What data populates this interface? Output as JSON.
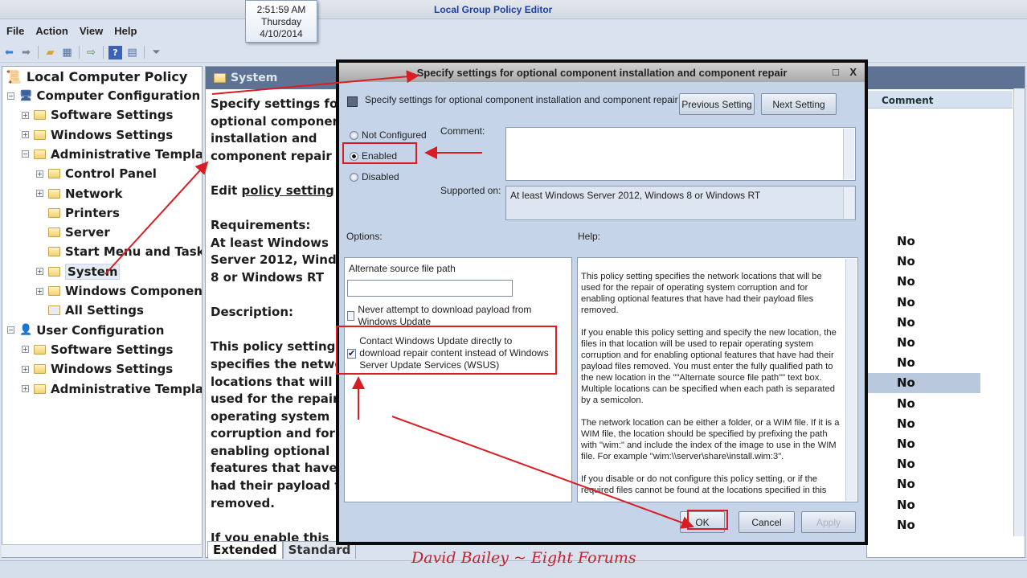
{
  "window": {
    "title": "Local Group Policy Editor"
  },
  "clock": {
    "time": "2:51:59 AM",
    "day": "Thursday",
    "date": "4/10/2014"
  },
  "menu": [
    "File",
    "Action",
    "View",
    "Help"
  ],
  "toolbar_icons": [
    "back-arrow-icon",
    "forward-arrow-icon",
    "up-folder-icon",
    "show-hide-tree-icon",
    "export-list-icon",
    "help-icon",
    "properties-icon",
    "filter-icon"
  ],
  "tree": {
    "root": "Local Computer Policy",
    "items": [
      {
        "label": "Computer Configuration",
        "level": 0,
        "expander": "minus"
      },
      {
        "label": "Software Settings",
        "level": 1,
        "expander": "plus"
      },
      {
        "label": "Windows Settings",
        "level": 1,
        "expander": "plus"
      },
      {
        "label": "Administrative Templates",
        "level": 1,
        "expander": "minus"
      },
      {
        "label": "Control Panel",
        "level": 2,
        "expander": "plus"
      },
      {
        "label": "Network",
        "level": 2,
        "expander": "plus"
      },
      {
        "label": "Printers",
        "level": 2,
        "expander": "none"
      },
      {
        "label": "Server",
        "level": 2,
        "expander": "none"
      },
      {
        "label": "Start Menu and Taskbar",
        "level": 2,
        "expander": "none"
      },
      {
        "label": "System",
        "level": 2,
        "expander": "plus",
        "selected": true
      },
      {
        "label": "Windows Components",
        "level": 2,
        "expander": "plus"
      },
      {
        "label": "All Settings",
        "level": 2,
        "expander": "none"
      },
      {
        "label": "User Configuration",
        "level": 0,
        "expander": "minus"
      },
      {
        "label": "Software Settings",
        "level": 1,
        "expander": "plus"
      },
      {
        "label": "Windows Settings",
        "level": 1,
        "expander": "plus"
      },
      {
        "label": "Administrative Templates",
        "level": 1,
        "expander": "plus"
      }
    ]
  },
  "middle": {
    "header": "System",
    "title": "Specify settings for optional component installation and component repair",
    "edit_prefix": "Edit",
    "edit_link": "policy setting",
    "requirements_label": "Requirements:",
    "requirements": "At least Windows Server 2012, Windows 8 or Windows RT",
    "description_label": "Description:",
    "description": "This policy setting specifies the network locations that will be used for the repair of operating system corruption and for enabling optional features that have had their payload files removed.",
    "more": "If you enable this",
    "tabs": [
      "Extended",
      "Standard"
    ]
  },
  "list": {
    "column": "Comment",
    "values": [
      "No",
      "No",
      "No",
      "No",
      "No",
      "No",
      "No",
      "No",
      "No",
      "No",
      "No",
      "No",
      "No",
      "No",
      "No"
    ],
    "selected_index": 7
  },
  "dialog": {
    "title": "Specify settings for optional component installation and component repair",
    "setting_name": "Specify settings for optional component installation and component repair",
    "prev": "Previous Setting",
    "next": "Next Setting",
    "radios": [
      {
        "label": "Not Configured",
        "checked": false
      },
      {
        "label": "Enabled",
        "checked": true
      },
      {
        "label": "Disabled",
        "checked": false
      }
    ],
    "comment_label": "Comment:",
    "comment_value": "",
    "supported_label": "Supported on:",
    "supported_value": "At least Windows Server 2012, Windows 8 or Windows RT",
    "options_label": "Options:",
    "help_label": "Help:",
    "alt_path_label": "Alternate source file path",
    "alt_path_value": "",
    "never_download": {
      "label": "Never attempt to download payload from Windows Update",
      "checked": false
    },
    "contact_wu": {
      "label": "Contact Windows Update directly to download repair content instead of Windows Server Update Services (WSUS)",
      "checked": true
    },
    "help": [
      "This policy setting specifies the network locations that will be used for the repair of operating system corruption and for enabling optional features that have had their payload files removed.",
      "If you enable this policy setting and specify the new location, the files in that location will be used to repair operating system corruption and for enabling optional features that have had their payload files removed. You must enter the fully qualified path to the new location in the \"\"Alternate source file path\"\" text box. Multiple locations can be specified when each path is separated by a semicolon.",
      "The network location can be either a folder, or a WIM file. If it is a WIM file, the location should be specified by prefixing the path with \"wim:\" and include the index of the image to use in the WIM file. For example \"wim:\\\\server\\share\\install.wim:3\".",
      "If you disable or do not configure this policy setting, or if the required files cannot be found at the locations specified in this"
    ],
    "ok": "OK",
    "cancel": "Cancel",
    "apply": "Apply",
    "maximize": "□",
    "close": "X"
  },
  "watermark": "David Bailey ~ Eight Forums",
  "colors": {
    "annotation": "#d81e24",
    "pane_header": "#5e7293",
    "dialog_bg": "#c6d4e9",
    "title_text": "#1b3fa8"
  }
}
